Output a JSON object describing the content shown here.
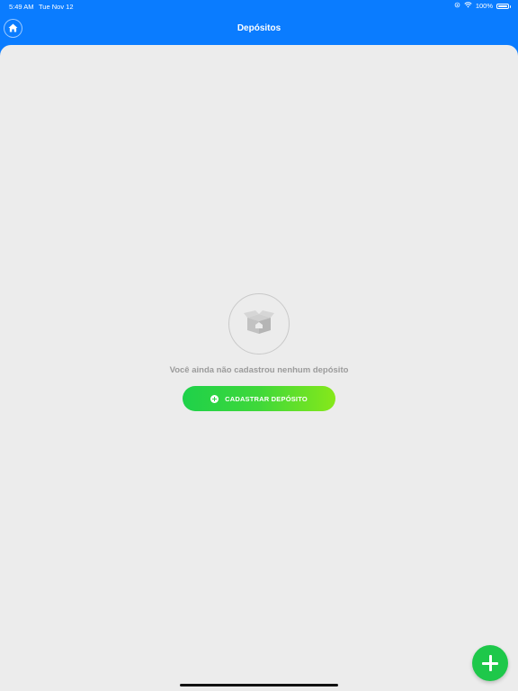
{
  "status_bar": {
    "time": "5:49 AM",
    "date": "Tue Nov 12",
    "battery": "100%"
  },
  "header": {
    "title": "Depósitos",
    "home_icon": "home-icon"
  },
  "empty_state": {
    "icon": "open-box-icon",
    "message": "Você ainda não cadastrou nenhum depósito",
    "button_label": "CADASTRAR DEPÓSITO",
    "button_icon": "plus-circle-icon"
  },
  "fab": {
    "icon": "plus-icon"
  },
  "colors": {
    "header_blue": "#0a7cff",
    "background": "#ececec",
    "accent_green": "#1ec84a",
    "gradient_end": "#86e81a"
  }
}
